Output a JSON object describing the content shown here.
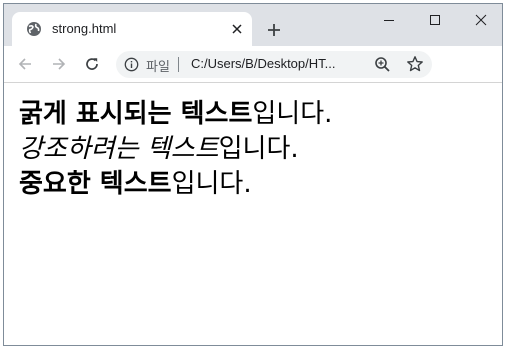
{
  "tab": {
    "title": "strong.html",
    "favicon": "globe-icon",
    "close_icon": "close-icon"
  },
  "new_tab_icon": "plus-icon",
  "window_controls": [
    "minimize-icon",
    "maximize-icon",
    "close-icon"
  ],
  "toolbar": {
    "back_icon": "arrow-left-icon",
    "forward_icon": "arrow-right-icon",
    "reload_icon": "reload-icon"
  },
  "omnibox": {
    "info_icon": "info-icon",
    "label": "파일",
    "url": "C:/Users/B/Desktop/HT...",
    "zoom_icon": "zoom-icon",
    "star_icon": "star-icon"
  },
  "content": {
    "line1": {
      "strong": "굵게 표시되는 텍스트",
      "rest": "입니다."
    },
    "line2": {
      "em": "강조하려는 텍스트",
      "rest": "입니다."
    },
    "line3": {
      "strong": "중요한 텍스트",
      "rest": "입니다."
    }
  }
}
